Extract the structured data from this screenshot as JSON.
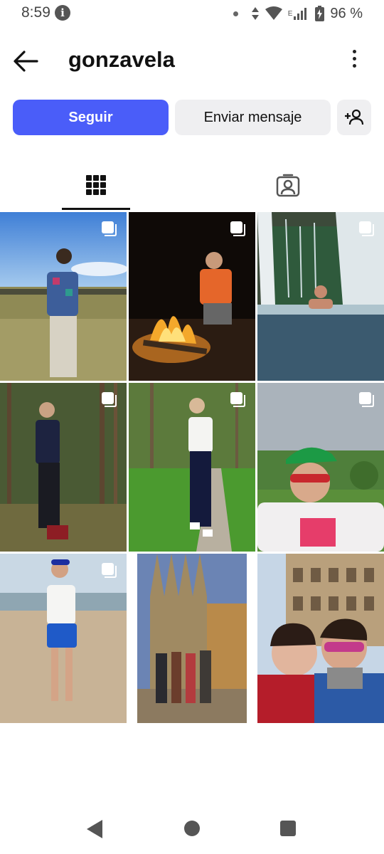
{
  "status_bar": {
    "time": "8:59",
    "network_label": "E",
    "battery_percent": "96 %"
  },
  "header": {
    "username": "gonzavela",
    "icons": [
      "back-arrow-icon",
      "more-vertical-icon"
    ]
  },
  "actions": {
    "follow_label": "Seguir",
    "message_label": "Enviar mensaje",
    "add_user_icon": "person-plus-icon"
  },
  "tabs": [
    {
      "icon": "grid-icon",
      "selected": true
    },
    {
      "icon": "tagged-person-icon",
      "selected": false
    }
  ],
  "posts": [
    {
      "scene": "festival field, person in patterned shirt",
      "multiple": true
    },
    {
      "scene": "campfire at night, person crouching",
      "multiple": true
    },
    {
      "scene": "waterfall pool, person swimming",
      "multiple": true
    },
    {
      "scene": "forest, person in black outfit",
      "multiple": true
    },
    {
      "scene": "park path, person in white t-shirt",
      "multiple": true
    },
    {
      "scene": "green cap selfie with sunglasses",
      "multiple": true
    },
    {
      "scene": "beach, person in blue shorts",
      "multiple": true
    },
    {
      "scene": "group in front of cathedral",
      "multiple": false
    },
    {
      "scene": "couple selfie at colosseum",
      "multiple": false
    }
  ],
  "colors": {
    "accent": "#4a5df9",
    "secondary_button": "#efeff1"
  }
}
